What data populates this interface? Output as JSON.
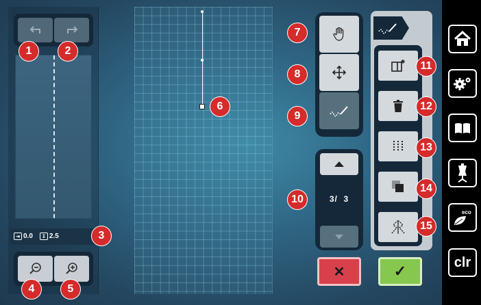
{
  "left_panel": {
    "undo_icon": "undo-icon",
    "redo_icon": "redo-icon",
    "info": {
      "width_value": "0.0",
      "length_value": "2.5"
    },
    "zoom_out_icon": "zoom-out-icon",
    "zoom_in_icon": "zoom-in-icon"
  },
  "tools": {
    "items": [
      {
        "icon": "hand-icon",
        "active": false
      },
      {
        "icon": "move-arrows-icon",
        "active": false
      },
      {
        "icon": "draw-stitch-icon",
        "active": true
      }
    ]
  },
  "page": {
    "current": "3/",
    "total": "3"
  },
  "tab": {
    "icon": "draw-stitch-icon"
  },
  "functions": [
    {
      "icon": "new-stitch-icon"
    },
    {
      "icon": "delete-icon"
    },
    {
      "icon": "grid-icon"
    },
    {
      "icon": "duplicate-icon"
    },
    {
      "icon": "mirror-stitch-icon"
    }
  ],
  "actions": {
    "cancel": "✕",
    "confirm": "✓"
  },
  "nav": {
    "items": [
      {
        "icon": "home-icon"
      },
      {
        "icon": "settings-icon"
      },
      {
        "icon": "book-icon"
      },
      {
        "icon": "dress-form-icon"
      },
      {
        "icon": "eco-leaf-icon"
      }
    ],
    "clr_label": "clr"
  },
  "callouts": [
    "1",
    "2",
    "3",
    "4",
    "5",
    "6",
    "7",
    "8",
    "9",
    "10",
    "11",
    "12",
    "13",
    "14",
    "15"
  ],
  "colors": {
    "callout_red": "#d52b2b",
    "cancel_red": "#d8404c",
    "confirm_green": "#86c84e",
    "panel_dark": "#14283a"
  }
}
